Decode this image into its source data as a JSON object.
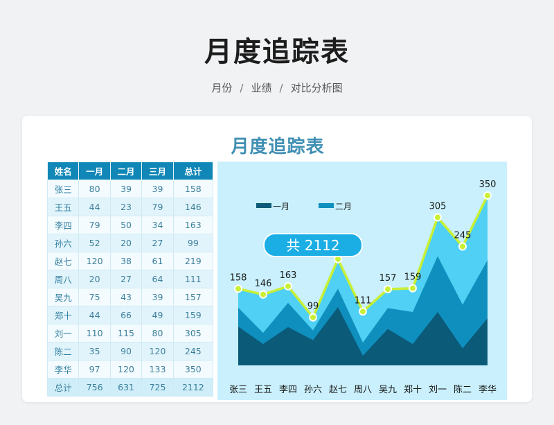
{
  "header": {
    "title": "月度追踪表",
    "breadcrumb": [
      "月份",
      "业绩",
      "对比分析图"
    ]
  },
  "sheet": {
    "title": "月度追踪表",
    "columns": [
      "姓名",
      "一月",
      "二月",
      "三月",
      "总计"
    ],
    "rows": [
      [
        "张三",
        "80",
        "39",
        "39",
        "158"
      ],
      [
        "王五",
        "44",
        "23",
        "79",
        "146"
      ],
      [
        "李四",
        "79",
        "50",
        "34",
        "163"
      ],
      [
        "孙六",
        "52",
        "20",
        "27",
        "99"
      ],
      [
        "赵七",
        "120",
        "38",
        "61",
        "219"
      ],
      [
        "周八",
        "20",
        "27",
        "64",
        "111"
      ],
      [
        "吴九",
        "75",
        "43",
        "39",
        "157"
      ],
      [
        "郑十",
        "44",
        "66",
        "49",
        "159"
      ],
      [
        "刘一",
        "110",
        "115",
        "80",
        "305"
      ],
      [
        "陈二",
        "35",
        "90",
        "120",
        "245"
      ],
      [
        "李华",
        "97",
        "120",
        "133",
        "350"
      ]
    ],
    "total_row": [
      "总计",
      "756",
      "631",
      "725",
      "2112"
    ]
  },
  "colors": {
    "header_bg": "#1087b6",
    "chart_bg": "#c9f0fc",
    "series_jan": "#0a5a78",
    "series_feb": "#0f8fbd",
    "series_mar": "#4fd0f4",
    "total_line": "#c8f034"
  },
  "chart_data": {
    "type": "area",
    "categories": [
      "张三",
      "王五",
      "李四",
      "孙六",
      "赵七",
      "周八",
      "吴九",
      "郑十",
      "刘一",
      "陈二",
      "李华"
    ],
    "series": [
      {
        "name": "一月",
        "values": [
          80,
          44,
          79,
          52,
          120,
          20,
          75,
          44,
          110,
          35,
          97
        ]
      },
      {
        "name": "二月",
        "values": [
          39,
          23,
          50,
          20,
          38,
          27,
          43,
          66,
          115,
          90,
          120
        ]
      },
      {
        "values": [
          39,
          79,
          34,
          27,
          61,
          64,
          39,
          49,
          80,
          120,
          133
        ]
      }
    ],
    "totals": {
      "values": [
        158,
        146,
        163,
        99,
        219,
        111,
        157,
        159,
        305,
        245,
        350
      ]
    },
    "stacked": true,
    "ylim": [
      0,
      400
    ],
    "legend": "top-left",
    "badge": "共 2112"
  }
}
